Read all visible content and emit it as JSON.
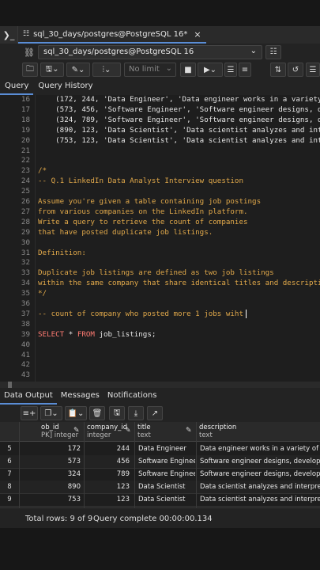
{
  "tab": {
    "label": "sql_30_days/postgres@PostgreSQL 16*",
    "close": "×"
  },
  "connection": {
    "label": "sql_30_days/postgres@PostgreSQL 16"
  },
  "toolbar": {
    "limit_placeholder": "No limit"
  },
  "query_tabs": [
    "Query",
    "Query History"
  ],
  "editor": {
    "lines": [
      {
        "n": "16",
        "segs": [
          {
            "c": "tx",
            "t": "    (172, 244, 'Data Engineer', 'Data engineer works in a variety"
          }
        ]
      },
      {
        "n": "17",
        "segs": [
          {
            "c": "tx",
            "t": "    (573, 456, 'Software Engineer', 'Software engineer designs, d"
          }
        ]
      },
      {
        "n": "18",
        "segs": [
          {
            "c": "tx",
            "t": "    (324, 789, 'Software Engineer', 'Software engineer designs, d"
          }
        ]
      },
      {
        "n": "19",
        "segs": [
          {
            "c": "tx",
            "t": "    (890, 123, 'Data Scientist', 'Data scientist analyzes and int"
          }
        ]
      },
      {
        "n": "20",
        "segs": [
          {
            "c": "tx",
            "t": "    (753, 123, 'Data Scientist', 'Data scientist analyzes and int"
          }
        ]
      },
      {
        "n": "21",
        "segs": []
      },
      {
        "n": "22",
        "segs": []
      },
      {
        "n": "23",
        "segs": [
          {
            "c": "cm",
            "t": "/*"
          }
        ]
      },
      {
        "n": "24",
        "segs": [
          {
            "c": "cm",
            "t": "-- Q.1 LinkedIn Data Analyst Interview question"
          }
        ]
      },
      {
        "n": "25",
        "segs": []
      },
      {
        "n": "26",
        "segs": [
          {
            "c": "cm",
            "t": "Assume you're given a table containing job postings"
          }
        ]
      },
      {
        "n": "27",
        "segs": [
          {
            "c": "cm",
            "t": "from various companies on the LinkedIn platform."
          }
        ]
      },
      {
        "n": "28",
        "segs": [
          {
            "c": "cm",
            "t": "Write a query to retrieve the count of companies"
          }
        ]
      },
      {
        "n": "29",
        "segs": [
          {
            "c": "cm",
            "t": "that have posted duplicate job listings."
          }
        ]
      },
      {
        "n": "30",
        "segs": []
      },
      {
        "n": "31",
        "segs": [
          {
            "c": "cm",
            "t": "Definition:"
          }
        ]
      },
      {
        "n": "32",
        "segs": []
      },
      {
        "n": "33",
        "segs": [
          {
            "c": "cm",
            "t": "Duplicate job listings are defined as two job listings"
          }
        ]
      },
      {
        "n": "34",
        "segs": [
          {
            "c": "cm",
            "t": "within the same company that share identical titles and descripti"
          }
        ]
      },
      {
        "n": "35",
        "segs": [
          {
            "c": "cm",
            "t": "*/"
          }
        ]
      },
      {
        "n": "36",
        "segs": []
      },
      {
        "n": "37",
        "segs": [
          {
            "c": "cm",
            "t": "-- count of company who posted more 1 jobs wiht"
          }
        ],
        "cursor": true
      },
      {
        "n": "38",
        "segs": []
      },
      {
        "n": "39",
        "segs": [
          {
            "c": "kw",
            "t": "SELECT"
          },
          {
            "c": "tx",
            "t": " * "
          },
          {
            "c": "kw",
            "t": "FROM"
          },
          {
            "c": "tx",
            "t": " job_listings;"
          }
        ]
      },
      {
        "n": "40",
        "segs": []
      },
      {
        "n": "41",
        "segs": []
      },
      {
        "n": "42",
        "segs": []
      },
      {
        "n": "43",
        "segs": []
      }
    ]
  },
  "output_tabs": [
    "Data Output",
    "Messages",
    "Notifications"
  ],
  "grid": {
    "columns": [
      {
        "name": "ob_id",
        "type": "PK] integer"
      },
      {
        "name": "company_id",
        "type": "integer"
      },
      {
        "name": "title",
        "type": "text"
      },
      {
        "name": "description",
        "type": "text"
      }
    ],
    "rows": [
      [
        "5",
        "172",
        "244",
        "Data Engineer",
        "Data engineer works in a variety of settings"
      ],
      [
        "6",
        "573",
        "456",
        "Software Engineer",
        "Software engineer designs, develops, tests,"
      ],
      [
        "7",
        "324",
        "789",
        "Software Engineer",
        "Software engineer designs, develops, tests,"
      ],
      [
        "8",
        "890",
        "123",
        "Data Scientist",
        "Data scientist analyzes and interprets comp"
      ],
      [
        "9",
        "753",
        "123",
        "Data Scientist",
        "Data scientist analyzes and interprets comp"
      ]
    ]
  },
  "status": {
    "rows": "Total rows: 9 of 9",
    "query": "Query complete 00:00:00.134"
  }
}
